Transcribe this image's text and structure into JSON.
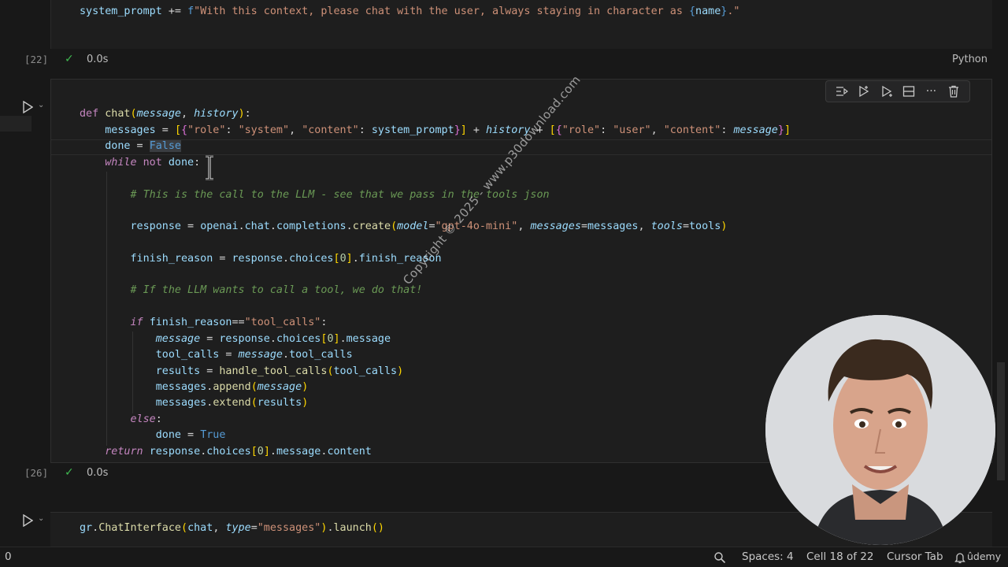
{
  "cells": {
    "top": {
      "code_line": {
        "var": "system_prompt",
        "op": " += ",
        "prefix": "f",
        "str_a": "\"With this context, please chat with the user, always staying in character as ",
        "brace_open": "{",
        "name": "name",
        "brace_close": "}",
        "str_b": ".\""
      },
      "exec_count": "[22]",
      "timing": "0.0s",
      "language": "Python"
    },
    "main": {
      "exec_count": "[26]",
      "timing": "0.0s",
      "lines": {
        "l1": {
          "def": "def",
          "fn": "chat",
          "p1": "message",
          "p2": "history"
        },
        "l2": {
          "var": "messages",
          "role_key": "\"role\"",
          "role_val": "\"system\"",
          "content_key": "\"content\"",
          "content_val": "system_prompt",
          "history": "history",
          "user_role_key": "\"role\"",
          "user_role_val": "\"user\"",
          "user_content_key": "\"content\"",
          "user_content_val": "message"
        },
        "l3": {
          "var": "done",
          "val": "False"
        },
        "l4": {
          "kw_while": "while",
          "kw_not": "not",
          "var": "done"
        },
        "l5": {
          "comment": "# This is the call to the LLM - see that we pass in the tools json"
        },
        "l6": {
          "var": "response",
          "obj": "openai",
          "a1": "chat",
          "a2": "completions",
          "fn": "create",
          "k1": "model",
          "v1": "\"gpt-4o-mini\"",
          "k2": "messages",
          "v2": "messages",
          "k3": "tools",
          "v3": "tools"
        },
        "l7": {
          "var": "finish_reason",
          "obj": "response",
          "a1": "choices",
          "idx": "0",
          "a2": "finish_reason"
        },
        "l8": {
          "comment": "# If the LLM wants to call a tool, we do that!"
        },
        "l9": {
          "kw": "if",
          "var": "finish_reason",
          "str": "\"tool_calls\""
        },
        "l10": {
          "var": "message",
          "obj": "response",
          "a1": "choices",
          "idx": "0",
          "a2": "message"
        },
        "l11": {
          "var": "tool_calls",
          "obj": "message",
          "a1": "tool_calls"
        },
        "l12": {
          "var": "results",
          "fn": "handle_tool_calls",
          "arg": "tool_calls"
        },
        "l13": {
          "obj": "messages",
          "fn": "append",
          "arg": "message"
        },
        "l14": {
          "obj": "messages",
          "fn": "extend",
          "arg": "results"
        },
        "l15": {
          "kw": "else"
        },
        "l16": {
          "var": "done",
          "val": "True"
        },
        "l17": {
          "kw": "return",
          "obj": "response",
          "a1": "choices",
          "idx": "0",
          "a2": "message",
          "a3": "content"
        }
      }
    },
    "last": {
      "code": {
        "obj": "gr",
        "fn": "ChatInterface",
        "arg": "chat",
        "k": "type",
        "v": "\"messages\"",
        "fn2": "launch"
      }
    }
  },
  "toolbar": {
    "icons": [
      "run-by-line-icon",
      "execute-above-icon",
      "execute-below-icon",
      "split-cell-icon",
      "more-icon",
      "delete-icon"
    ]
  },
  "watermark": "Copyright © 2025 - www.p30download.com",
  "statusbar": {
    "left_count": "0",
    "spaces": "Spaces: 4",
    "cell": "Cell 18 of 22",
    "cursor_tab": "Cursor Tab",
    "brand": "ûdemy"
  },
  "colors": {
    "background": "#181818",
    "cell_bg": "#1e1e1e",
    "success": "#3fb950",
    "keyword": "#c586c0",
    "function": "#dcdcaa",
    "string": "#ce9178",
    "comment": "#6a9955"
  }
}
